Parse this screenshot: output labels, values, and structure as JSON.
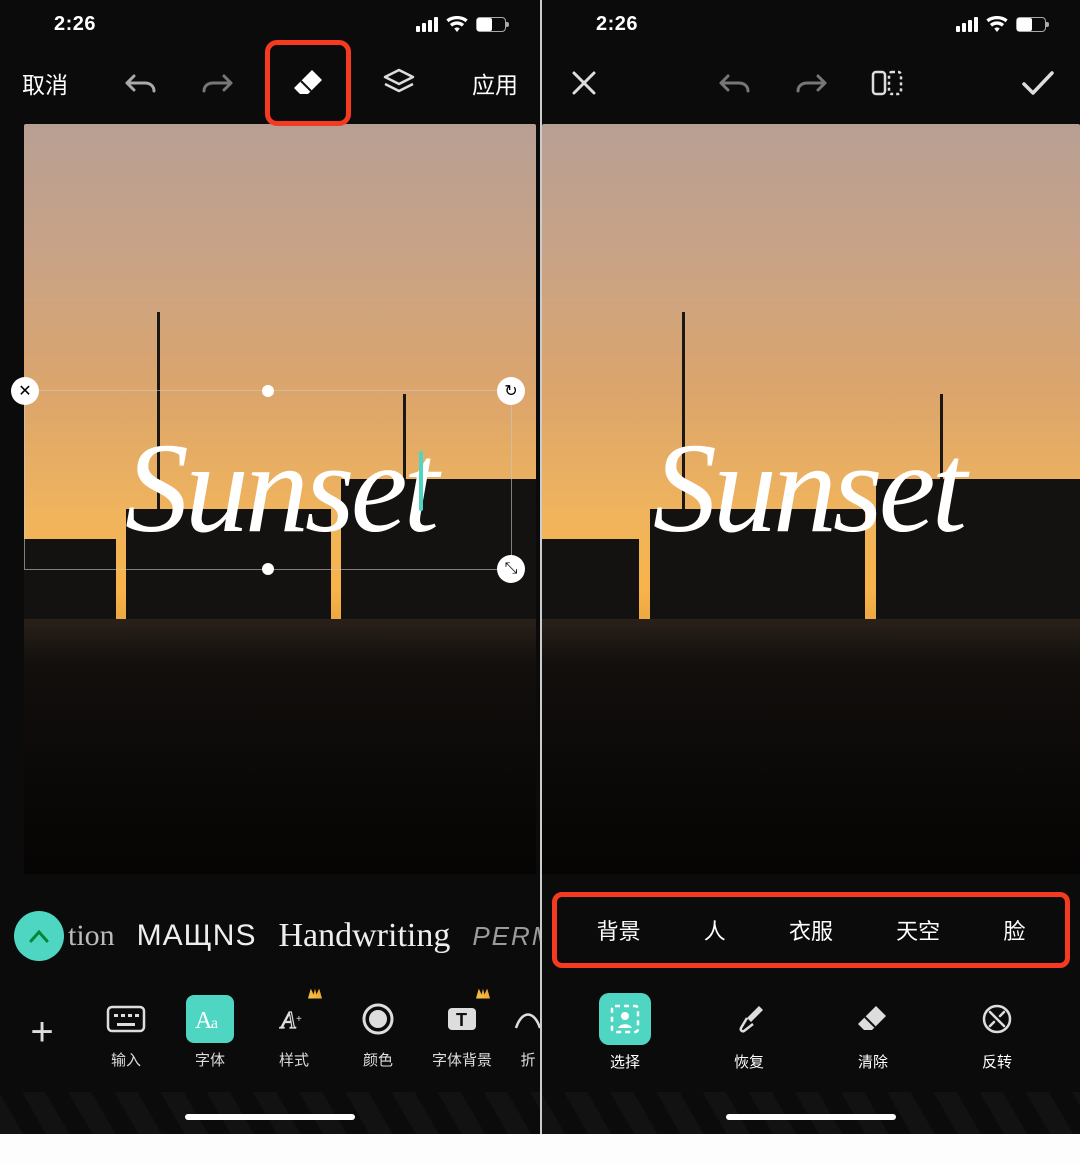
{
  "status": {
    "time": "2:26"
  },
  "left": {
    "topbar": {
      "cancel": "取消",
      "apply": "应用"
    },
    "text_overlay": "Sunset",
    "fonts": [
      "tion",
      "MAЩNS",
      "Handwriting",
      "PERMAN"
    ],
    "tooltabs": [
      {
        "label": "输入",
        "icon": "keyboard"
      },
      {
        "label": "字体",
        "icon": "font",
        "active": true
      },
      {
        "label": "样式",
        "icon": "style",
        "premium": true
      },
      {
        "label": "颜色",
        "icon": "color"
      },
      {
        "label": "字体背景",
        "icon": "textbg",
        "premium": true
      },
      {
        "label": "折",
        "icon": "bend"
      }
    ]
  },
  "right": {
    "text_overlay": "Sunset",
    "select_chips": [
      "背景",
      "人",
      "衣服",
      "天空",
      "脸"
    ],
    "tools": [
      {
        "label": "选择",
        "icon": "select",
        "active": true
      },
      {
        "label": "恢复",
        "icon": "brush"
      },
      {
        "label": "清除",
        "icon": "eraser"
      },
      {
        "label": "反转",
        "icon": "invert"
      }
    ]
  }
}
